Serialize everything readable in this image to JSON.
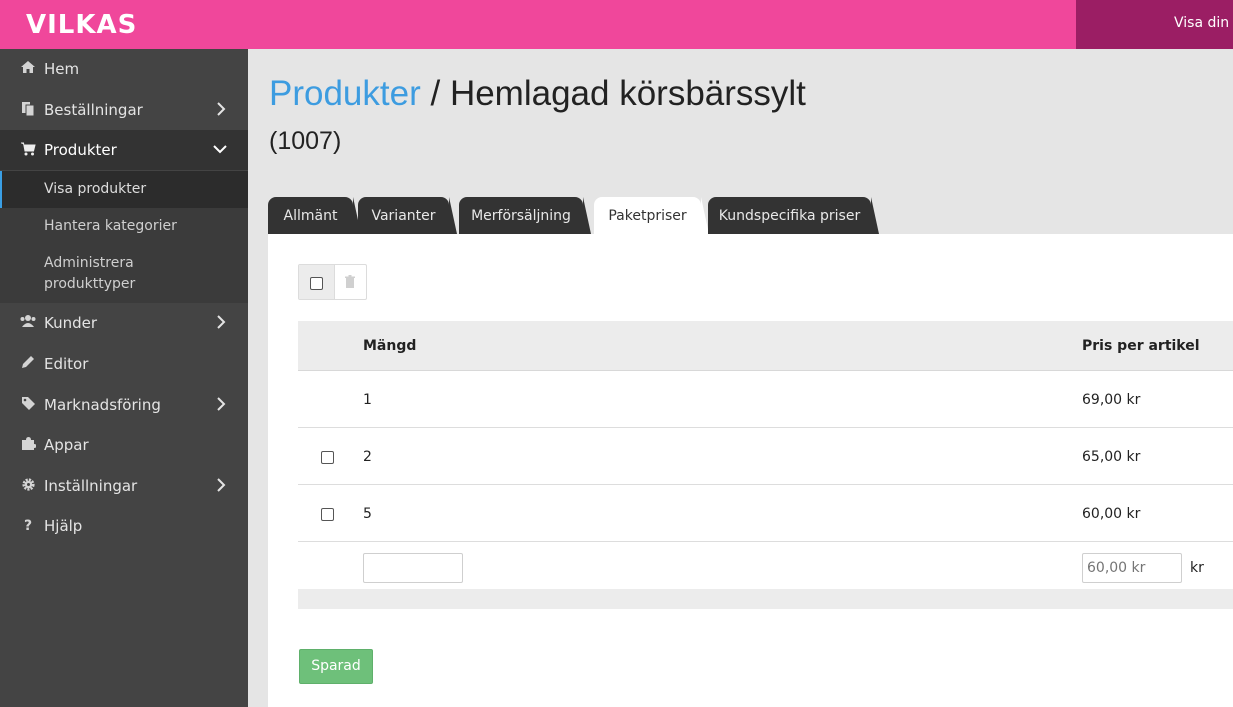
{
  "app": {
    "logo": "VILKAS",
    "top_right_text": "Visa din butik"
  },
  "sidebar": {
    "items": [
      {
        "label": "Hem",
        "icon": "home-icon"
      },
      {
        "label": "Beställningar",
        "icon": "orders-icon"
      },
      {
        "label": "Produkter",
        "icon": "cart-icon"
      },
      {
        "label": "Kunder",
        "icon": "users-icon"
      },
      {
        "label": "Editor",
        "icon": "pencil-icon"
      },
      {
        "label": "Marknadsföring",
        "icon": "tag-icon"
      },
      {
        "label": "Appar",
        "icon": "puzzle-icon"
      },
      {
        "label": "Inställningar",
        "icon": "gear-icon"
      },
      {
        "label": "Hjälp",
        "icon": "question-icon"
      }
    ],
    "subitems": [
      {
        "label": "Visa produkter"
      },
      {
        "label": "Hantera kategorier"
      },
      {
        "label": "Administrera produkttyper"
      }
    ]
  },
  "page": {
    "breadcrumb": "Produkter",
    "separator": " / ",
    "title": "Hemlagad körsbärssylt",
    "product_id": "(1007)"
  },
  "tabs": [
    {
      "label": "Allmänt"
    },
    {
      "label": "Varianter"
    },
    {
      "label": "Merförsäljning"
    },
    {
      "label": "Paketpriser",
      "active": true
    },
    {
      "label": "Kundspecifika priser"
    }
  ],
  "table": {
    "headers": {
      "quantity": "Mängd",
      "price": "Pris per artikel"
    },
    "rows": [
      {
        "quantity": "1",
        "price": "69,00 kr"
      },
      {
        "quantity": "2",
        "price": "65,00 kr"
      },
      {
        "quantity": "5",
        "price": "60,00 kr"
      }
    ],
    "new_row": {
      "quantity_value": "",
      "price_placeholder": "60,00 kr",
      "currency": "kr"
    }
  },
  "save_button": "Sparad",
  "colors": {
    "topbar": "#f0479b",
    "topbar_right": "#9b1e64",
    "sidebar": "#444444",
    "breadcrumb_link": "#3d9ce0",
    "save_button": "#6ec07a"
  }
}
